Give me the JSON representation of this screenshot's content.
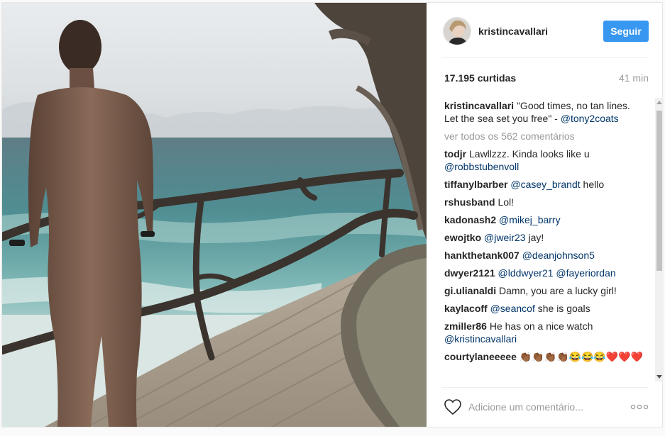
{
  "post": {
    "username": "kristincavallari",
    "follow_label": "Seguir",
    "likes": "17.195 curtidas",
    "time": "41 min",
    "caption": {
      "user": "kristincavallari",
      "text": "\"Good times, no tan lines. Let the sea set you free\" - ",
      "mention": "@tony2coats"
    },
    "view_all": "ver todos os 562 comentários",
    "comments": [
      {
        "user": "todjr",
        "text": "Lawllzzz. Kinda looks like u ",
        "mention": "@robbstubenvoll",
        "after": ""
      },
      {
        "user": "tiffanylbarber",
        "text": "",
        "mention": "@casey_brandt",
        "after": " hello"
      },
      {
        "user": "rshusband",
        "text": "Lol!",
        "mention": "",
        "after": ""
      },
      {
        "user": "kadonash2",
        "text": "",
        "mention": "@mikej_barry",
        "after": ""
      },
      {
        "user": "ewojtko",
        "text": "",
        "mention": "@jweir23",
        "after": " jay!"
      },
      {
        "user": "hankthetank007",
        "text": "",
        "mention": "@deanjohnson5",
        "after": ""
      },
      {
        "user": "dwyer2121",
        "text": "",
        "mention": "@lddwyer21 @fayeriordan",
        "after": ""
      },
      {
        "user": "gi.ulianaldi",
        "text": "Damn, you are a lucky girl!",
        "mention": "",
        "after": ""
      },
      {
        "user": "kaylacoff",
        "text": "",
        "mention": "@seancof",
        "after": " she is goals"
      },
      {
        "user": "zmiller86",
        "text": "He has on a nice watch ",
        "mention": "@kristincavallari",
        "after": ""
      },
      {
        "user": "courtylaneeeee",
        "text": "👏🏾👏🏾👏🏾👏🏾😂😂😂❤️❤️❤️",
        "mention": "",
        "after": ""
      }
    ],
    "add_comment_placeholder": "Adicione um comentário...",
    "icons": {
      "like": "heart-icon",
      "more": "more-options-icon"
    },
    "colors": {
      "follow": "#3897f0",
      "link": "#003569",
      "muted": "#999999"
    }
  }
}
